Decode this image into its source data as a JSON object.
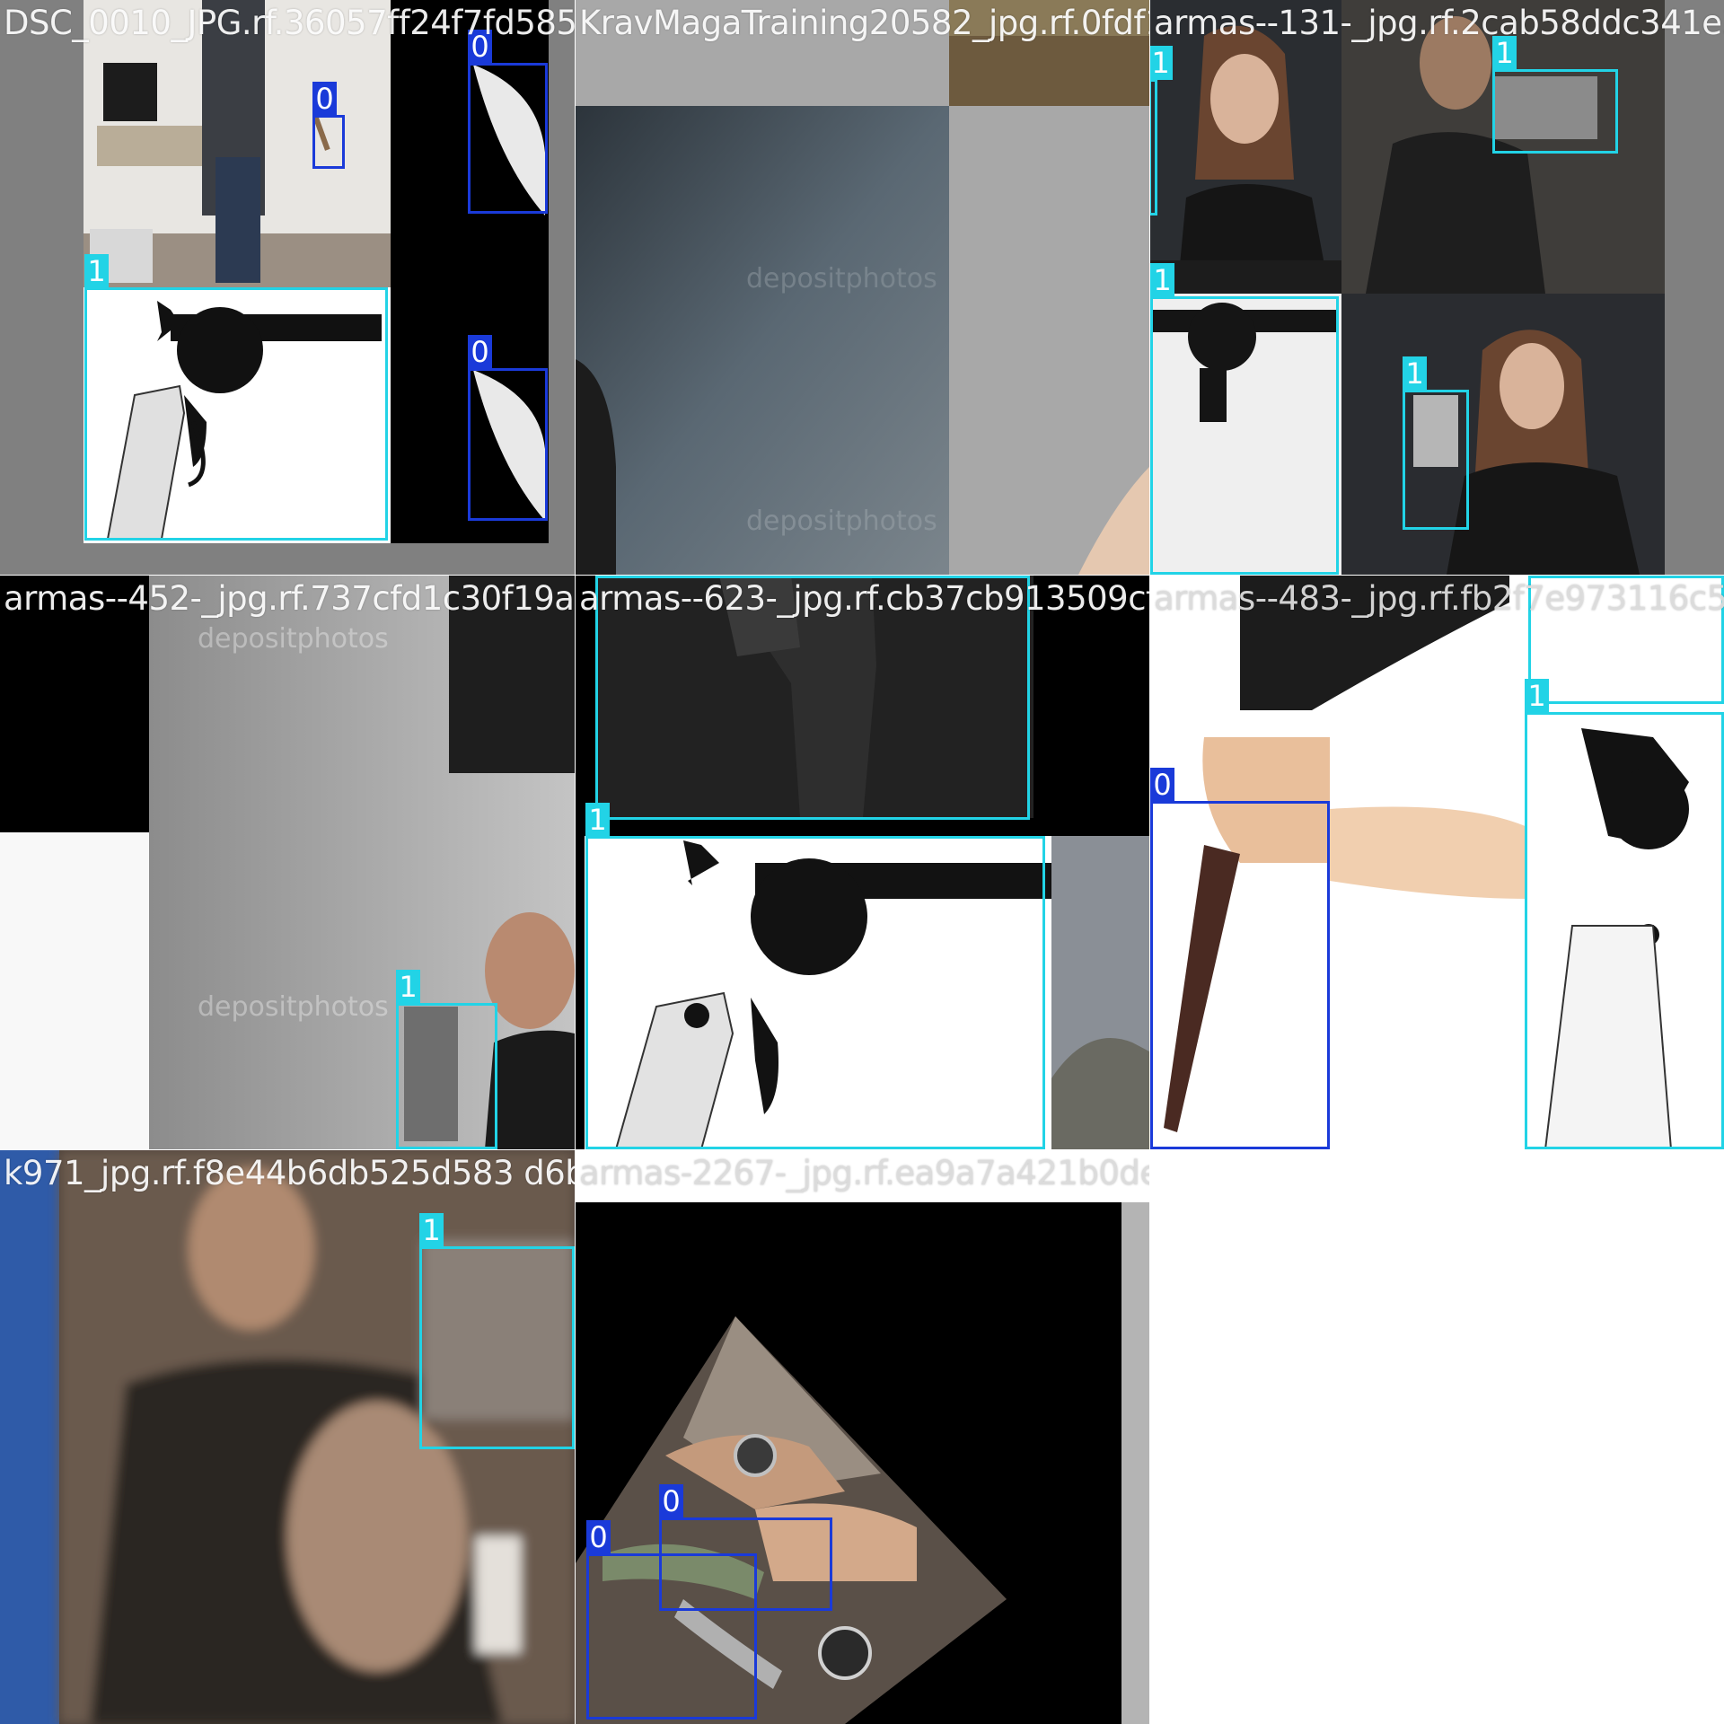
{
  "colors": {
    "class_0": "#1a3ad9",
    "class_1": "#22d3e6"
  },
  "tiles": [
    {
      "file": "DSC_0010_JPG.rf.36057ff24f7fd5853f5d4f14",
      "boxes": [
        {
          "label": "0"
        },
        {
          "label": "0"
        },
        {
          "label": "0"
        },
        {
          "label": "1"
        }
      ]
    },
    {
      "file": "KravMagaTraining20582_jpg.rf.0fdf17a05c0",
      "boxes": []
    },
    {
      "file": "armas--131-_jpg.rf.2cab58ddc341e33",
      "boxes": [
        {
          "label": "1"
        },
        {
          "label": "1"
        },
        {
          "label": "1"
        },
        {
          "label": "1"
        }
      ]
    },
    {
      "file": "armas--452-_jpg.rf.737cfd1c30f19adea05fa",
      "boxes": [
        {
          "label": "1"
        }
      ]
    },
    {
      "file": "armas--623-_jpg.rf.cb37cb913509cfda3a67",
      "boxes": [
        {
          "label": "1"
        },
        {
          "label": "1"
        },
        {
          "label": "1"
        }
      ]
    },
    {
      "file": "armas--483-_jpg.rf.fb2f7e973116c526",
      "boxes": [
        {
          "label": "1"
        },
        {
          "label": "1"
        },
        {
          "label": "0"
        }
      ]
    },
    {
      "file": "k971_jpg.rf.f8e44b6db525d583 d6b623e",
      "boxes": [
        {
          "label": "1"
        }
      ]
    },
    {
      "file": "armas-2267-_jpg.rf.ea9a7a421b0de9d99e0e",
      "boxes": [
        {
          "label": "0"
        },
        {
          "label": "0"
        }
      ]
    }
  ]
}
